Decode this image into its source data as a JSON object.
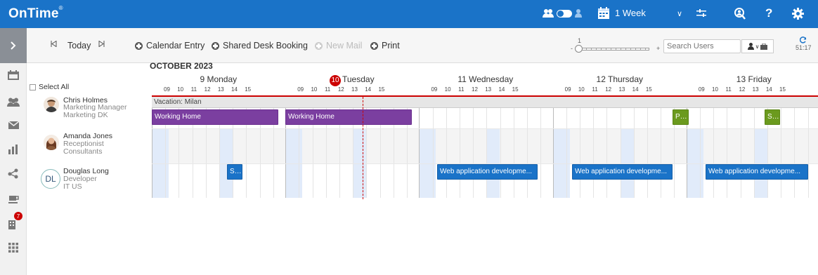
{
  "app": {
    "logo": "OnTime",
    "logo_mark": "®"
  },
  "topbar": {
    "view_label": "1 Week",
    "chevron": "∨",
    "settings_icon": "gear-icon",
    "help_label": "?"
  },
  "toolbar": {
    "today_label": "Today",
    "calendar_entry_label": "Calendar Entry",
    "shared_desk_label": "Shared Desk Booking",
    "new_mail_label": "New Mail",
    "print_label": "Print",
    "zoom_value": "1",
    "zoom_minus": "-",
    "zoom_plus": "+",
    "search_placeholder": "Search Users",
    "refresh_time": "51:17"
  },
  "sidebar": {
    "badge_count": "7"
  },
  "left_panel": {
    "select_all_label": "Select All",
    "users": [
      {
        "name": "Chris Holmes",
        "title": "Marketing Manager",
        "dept": "Marketing DK"
      },
      {
        "name": "Amanda Jones",
        "title": "Receptionist",
        "dept": "Consultants"
      },
      {
        "name": "Douglas Long",
        "title": "Developer",
        "dept": "IT US",
        "initials": "DL"
      }
    ]
  },
  "calendar": {
    "month": "OCTOBER 2023",
    "days": [
      {
        "label": "9 Monday"
      },
      {
        "label": "Tuesday",
        "day_num": "10"
      },
      {
        "label": "11 Wednesday"
      },
      {
        "label": "12 Thursday"
      },
      {
        "label": "13 Friday"
      }
    ],
    "hours": [
      "09",
      "10",
      "11",
      "12",
      "13",
      "14",
      "15"
    ],
    "vacation_label": "Vacation: Milan",
    "events": {
      "wh1": "Working Home",
      "wh2": "Working Home",
      "pr": "Pr...",
      "st1": "St...",
      "st2": "St...",
      "web1": "Web application developme...",
      "web2": "Web application developme...",
      "web3": "Web application developme..."
    }
  }
}
